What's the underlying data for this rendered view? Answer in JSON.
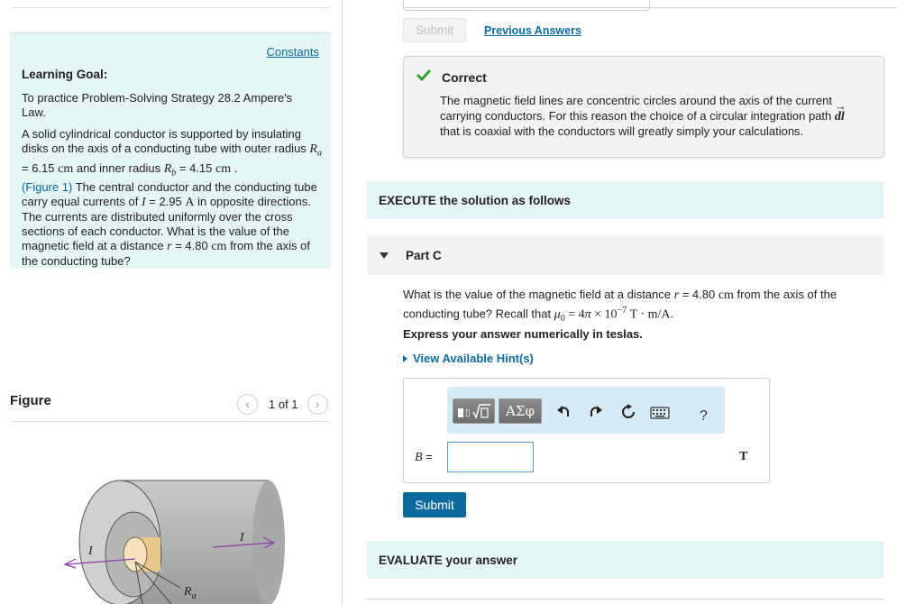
{
  "colors": {
    "accent": "#0b6aa2",
    "info_bg": "#e6f5f5",
    "correct_green": "#2e9e2e",
    "submit_bg": "#0c6a9c"
  },
  "left": {
    "constants_link": "Constants",
    "goal_title": "Learning Goal:",
    "goal_intro": "To practice Problem-Solving Strategy 28.2 Ampere's Law.",
    "problem": {
      "p1": "A solid cylindrical conductor is supported by insulating disks on the axis of a conducting tube with outer radius",
      "Ra_sym": "R",
      "Ra_sub": "a",
      "Ra_val": " = 6.15 ",
      "unit_cm": "cm",
      "p2": " and inner radius ",
      "Rb_sym": "R",
      "Rb_sub": "b",
      "Rb_val": " = 4.15 ",
      "period": " .",
      "figure_link": "(Figure 1)",
      "p3": " The central conductor and the conducting tube carry equal currents of ",
      "I_sym": "I",
      "I_val": " = 2.95 ",
      "unit_A": "A",
      "p4": " in opposite directions. The currents are distributed uniformly over the cross sections of each conductor. What is the value of the magnetic field at a distance ",
      "r_sym": "r",
      "r_val": " = 4.80 ",
      "p5": " from the axis of the conducting tube?"
    },
    "figure_label": "Figure",
    "pager_text": "1 of 1",
    "figure_labels": {
      "I_left": "I",
      "I_right": "I",
      "Ra": "R",
      "Ra_sub": "a"
    }
  },
  "right": {
    "submit_disabled": "Submit",
    "previous_answers": "Previous Answers",
    "feedback": {
      "status": "Correct",
      "t1": "The magnetic field lines are concentric circles around the axis of the current carrying conductors. For this reason the choice of a circular integration path ",
      "dl": "dl",
      "t2": " that is coaxial with the conductors will greatly simply your calculations."
    },
    "execute_label": "EXECUTE the solution as follows",
    "part_title": "Part C",
    "question": {
      "q1": "What is the value of the magnetic field at a distance ",
      "r_sym": "r",
      "r_val": " = 4.80 ",
      "unit_cm": "cm",
      "q2": " from the axis of the conducting tube? Recall that ",
      "mu": "μ",
      "mu_sub": "0",
      "eq": " = 4",
      "pi": "π",
      "times": " × 10",
      "exp": "−7",
      "units": " T · m/A",
      "end": "."
    },
    "instruction": "Express your answer numerically in teslas.",
    "hints_label": "View Available Hint(s)",
    "toolbar": {
      "symbols": "ΑΣφ",
      "help": "?"
    },
    "answer": {
      "var_sym": "B",
      "var_eq": " =",
      "value": "",
      "unit": "T"
    },
    "submit_label": "Submit",
    "evaluate_label": "EVALUATE your answer"
  }
}
